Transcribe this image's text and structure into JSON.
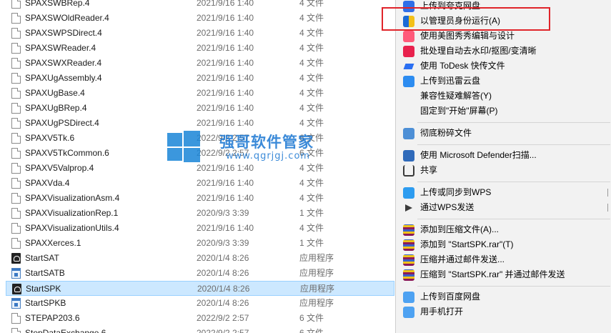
{
  "files": [
    {
      "name": "SPAXSWBRep.4",
      "date": "2021/9/16 1:40",
      "type": "4 文件",
      "icon": "file-icon"
    },
    {
      "name": "SPAXSWOldReader.4",
      "date": "2021/9/16 1:40",
      "type": "4 文件",
      "icon": "file-icon"
    },
    {
      "name": "SPAXSWPSDirect.4",
      "date": "2021/9/16 1:40",
      "type": "4 文件",
      "icon": "file-icon"
    },
    {
      "name": "SPAXSWReader.4",
      "date": "2021/9/16 1:40",
      "type": "4 文件",
      "icon": "file-icon"
    },
    {
      "name": "SPAXSWXReader.4",
      "date": "2021/9/16 1:40",
      "type": "4 文件",
      "icon": "file-icon"
    },
    {
      "name": "SPAXUgAssembly.4",
      "date": "2021/9/16 1:40",
      "type": "4 文件",
      "icon": "file-icon"
    },
    {
      "name": "SPAXUgBase.4",
      "date": "2021/9/16 1:40",
      "type": "4 文件",
      "icon": "file-icon"
    },
    {
      "name": "SPAXUgBRep.4",
      "date": "2021/9/16 1:40",
      "type": "4 文件",
      "icon": "file-icon"
    },
    {
      "name": "SPAXUgPSDirect.4",
      "date": "2021/9/16 1:40",
      "type": "4 文件",
      "icon": "file-icon"
    },
    {
      "name": "SPAXV5Tk.6",
      "date": "2022/9/2 2:57",
      "type": "6 文件",
      "icon": "file-icon"
    },
    {
      "name": "SPAXV5TkCommon.6",
      "date": "2022/9/2 2:57",
      "type": "6 文件",
      "icon": "file-icon"
    },
    {
      "name": "SPAXV5Valprop.4",
      "date": "2021/9/16 1:40",
      "type": "4 文件",
      "icon": "file-icon"
    },
    {
      "name": "SPAXVda.4",
      "date": "2021/9/16 1:40",
      "type": "4 文件",
      "icon": "file-icon"
    },
    {
      "name": "SPAXVisualizationAsm.4",
      "date": "2021/9/16 1:40",
      "type": "4 文件",
      "icon": "file-icon"
    },
    {
      "name": "SPAXVisualizationRep.1",
      "date": "2020/9/3 3:39",
      "type": "1 文件",
      "icon": "file-icon"
    },
    {
      "name": "SPAXVisualizationUtils.4",
      "date": "2021/9/16 1:40",
      "type": "4 文件",
      "icon": "file-icon"
    },
    {
      "name": "SPAXXerces.1",
      "date": "2020/9/3 3:39",
      "type": "1 文件",
      "icon": "file-icon"
    },
    {
      "name": "StartSAT",
      "date": "2020/1/4 8:26",
      "type": "应用程序",
      "icon": "exe-icon"
    },
    {
      "name": "StartSATB",
      "date": "2020/1/4 8:26",
      "type": "应用程序",
      "icon": "app-icon"
    },
    {
      "name": "StartSPK",
      "date": "2020/1/4 8:26",
      "type": "应用程序",
      "icon": "exe-icon",
      "selected": true
    },
    {
      "name": "StartSPKB",
      "date": "2020/1/4 8:26",
      "type": "应用程序",
      "icon": "app-icon"
    },
    {
      "name": "STEPAP203.6",
      "date": "2022/9/2 2:57",
      "type": "6 文件",
      "icon": "file-icon"
    },
    {
      "name": "StepDataExchange.6",
      "date": "2022/9/2 2:57",
      "type": "6 文件",
      "icon": "file-icon"
    }
  ],
  "watermark": {
    "title": "强哥软件管家",
    "url": "www.qgrjgj.com"
  },
  "menu": [
    {
      "label": "上传到夸克网盘",
      "icon": "quark-cloud-icon"
    },
    {
      "label": "以管理员身份运行(A)",
      "icon": "uac-shield-icon",
      "highlighted": true
    },
    {
      "label": "使用美图秀秀编辑与设计",
      "icon": "meitu-icon"
    },
    {
      "label": "批处理自动去水印/抠图/变清晰",
      "icon": "batch-process-icon"
    },
    {
      "label": "使用 ToDesk 快传文件",
      "icon": "todesk-icon"
    },
    {
      "label": "上传到迅雷云盘",
      "icon": "xunlei-icon"
    },
    {
      "label": "兼容性疑难解答(Y)",
      "icon": ""
    },
    {
      "label": "固定到\"开始\"屏幕(P)",
      "icon": ""
    },
    {
      "separator": true
    },
    {
      "label": "彻底粉碎文件",
      "icon": "shred-icon"
    },
    {
      "separator": true
    },
    {
      "label": "使用 Microsoft Defender扫描...",
      "icon": "defender-icon"
    },
    {
      "label": "共享",
      "icon": "share-icon"
    },
    {
      "separator": true
    },
    {
      "label": "上传或同步到WPS",
      "icon": "wps-cloud-icon",
      "submenu": true
    },
    {
      "label": "通过WPS发送",
      "icon": "send-arrow-icon",
      "submenu": true
    },
    {
      "separator": true
    },
    {
      "label": "添加到压缩文件(A)...",
      "icon": "rar-icon"
    },
    {
      "label": "添加到 \"StartSPK.rar\"(T)",
      "icon": "rar-icon"
    },
    {
      "label": "压缩并通过邮件发送...",
      "icon": "rar-icon"
    },
    {
      "label": "压缩到 \"StartSPK.rar\" 并通过邮件发送",
      "icon": "rar-icon"
    },
    {
      "separator": true
    },
    {
      "label": "上传到百度网盘",
      "icon": "baidu-cloud-icon"
    },
    {
      "label": "用手机打开",
      "icon": "phone-icon"
    }
  ]
}
